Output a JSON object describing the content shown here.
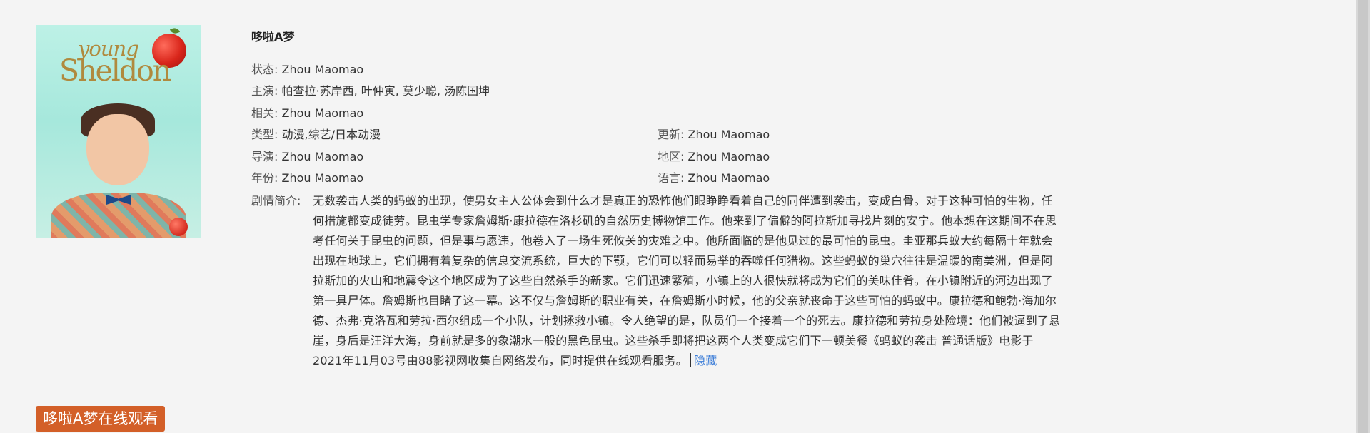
{
  "poster": {
    "logo_line1": "young",
    "logo_line2": "Sheldon",
    "icon": "poster-image"
  },
  "title": "哆啦A梦",
  "info": {
    "status_label": "状态:",
    "status_value": "Zhou Maomao",
    "cast_label": "主演:",
    "cast_value": "帕查拉·苏岸西, 叶仲寅, 莫少聪, 汤陈国坤",
    "related_label": "相关:",
    "related_value": "Zhou Maomao",
    "genre_label": "类型:",
    "genre_value": "动漫,综艺/日本动漫",
    "update_label": "更新:",
    "update_value": "Zhou Maomao",
    "director_label": "导演:",
    "director_value": "Zhou Maomao",
    "region_label": "地区:",
    "region_value": "Zhou Maomao",
    "year_label": "年份:",
    "year_value": "Zhou Maomao",
    "language_label": "语言:",
    "language_value": "Zhou Maomao"
  },
  "plot": {
    "label": "剧情简介:",
    "text": "无数袭击人类的蚂蚁的出现，使男女主人公体会到什么才是真正的恐怖他们眼睁睁看着自己的同伴遭到袭击，变成白骨。对于这种可怕的生物，任何措施都变成徒劳。昆虫学专家詹姆斯·康拉德在洛杉矶的自然历史博物馆工作。他来到了偏僻的阿拉斯加寻找片刻的安宁。他本想在这期间不在思考任何关于昆虫的问题，但是事与愿违，他卷入了一场生死攸关的灾难之中。他所面临的是他见过的最可怕的昆虫。圭亚那兵蚁大约每隔十年就会出现在地球上，它们拥有着复杂的信息交流系统，巨大的下颚，它们可以轻而易举的吞噬任何猎物。这些蚂蚁的巢穴往往是温暖的南美洲，但是阿拉斯加的火山和地震令这个地区成为了这些自然杀手的新家。它们迅速繁殖，小镇上的人很快就将成为它们的美味佳肴。在小镇附近的河边出现了第一具尸体。詹姆斯也目睹了这一幕。这不仅与詹姆斯的职业有关，在詹姆斯小时候，他的父亲就丧命于这些可怕的蚂蚁中。康拉德和鲍勃·海加尔德、杰弗·克洛瓦和劳拉·西尔组成一个小队，计划拯救小镇。令人绝望的是，队员们一个接着一个的死去。康拉德和劳拉身处险境：他们被逼到了悬崖，身后是汪洋大海，身前就是多的象潮水一般的黑色昆虫。这些杀手即将把这两个人类变成它们下一顿美餐《蚂蚁的袭击 普通话版》电影于2021年11月03号由88影视网收集自网络发布，同时提供在线观看服务。",
    "hide_link": "隐藏"
  },
  "watch_button": "哆啦A梦在线观看",
  "colors": {
    "background": "#f4f4f4",
    "button": "#d35f28",
    "link": "#3b7dd8"
  }
}
